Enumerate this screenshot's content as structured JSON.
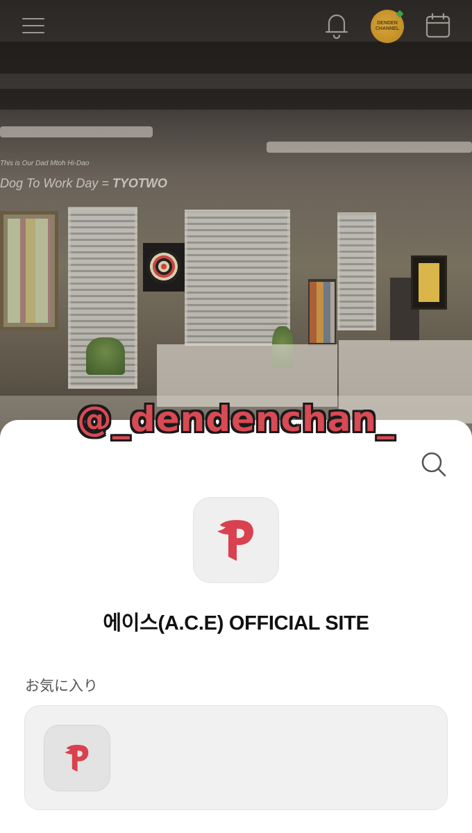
{
  "header": {
    "menu_icon": "hamburger-menu-icon",
    "notification_icon": "bell-icon",
    "profile": {
      "avatar_text": "DENDEN CHANNEL",
      "color": "#c9962b"
    },
    "calendar_icon": "calendar-icon"
  },
  "hero": {
    "wall_text_line1": "Dog To Work Day =",
    "wall_text_brand": "TYOTWO"
  },
  "watermark": {
    "text": "@_dendenchan_",
    "color": "#d84a54"
  },
  "sheet": {
    "search_icon": "search-icon",
    "app_logo": {
      "icon": "p-brand-logo-icon",
      "color": "#d9414f"
    },
    "site_title": "에이스(A.C.E) OFFICIAL SITE",
    "favorites": {
      "label": "お気に入り",
      "items": [
        {
          "icon": "p-brand-logo-icon"
        }
      ]
    }
  }
}
